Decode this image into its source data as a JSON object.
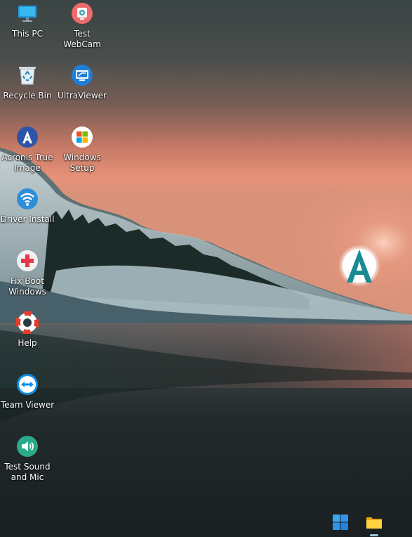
{
  "desktop": {
    "icons": [
      {
        "label": "This PC",
        "icon": "monitor-icon"
      },
      {
        "label": "Test WebCam",
        "icon": "webcam-icon"
      },
      {
        "label": "Recycle Bin",
        "icon": "recycle-bin-icon"
      },
      {
        "label": "UltraViewer",
        "icon": "ultraviewer-icon"
      },
      {
        "label": "Acronis True\nImage",
        "icon": "acronis-icon"
      },
      {
        "label": "Windows\nSetup",
        "icon": "windows-setup-icon"
      },
      {
        "label": "Driver Install",
        "icon": "wifi-icon"
      },
      {
        "label": "Fix Boot\nWindows",
        "icon": "medical-cross-icon"
      },
      {
        "label": "Help",
        "icon": "lifebuoy-icon"
      },
      {
        "label": "Team Viewer",
        "icon": "teamviewer-icon"
      },
      {
        "label": "Test Sound\nand Mic",
        "icon": "speaker-icon"
      }
    ]
  },
  "wallpaper_logo": {
    "letter": "A",
    "color": "#1a8a94"
  },
  "taskbar": {
    "items": [
      {
        "icon": "windows-start-icon"
      },
      {
        "icon": "file-explorer-icon"
      }
    ]
  }
}
